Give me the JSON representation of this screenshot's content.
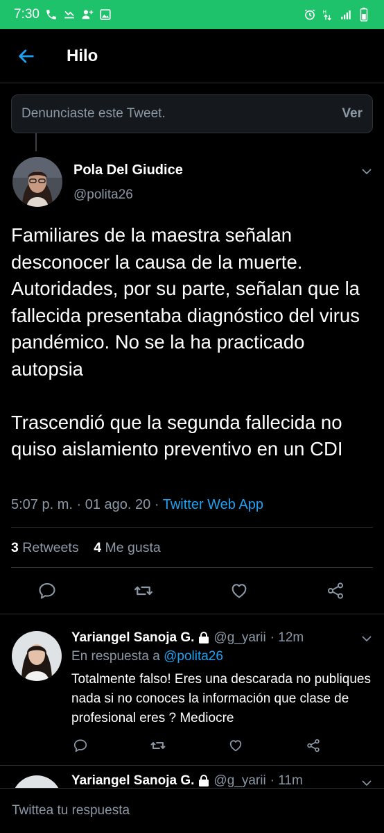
{
  "status_bar": {
    "time": "7:30",
    "left_icons": [
      "phone-call-icon",
      "missed-call-icon",
      "add-contact-icon",
      "gallery-icon"
    ],
    "right_icons": [
      "alarm-icon",
      "data-arrows-icon",
      "signal-icon",
      "battery-icon"
    ],
    "color": "#1dc26a"
  },
  "header": {
    "back_icon": "arrow-left-icon",
    "title": "Hilo"
  },
  "reported_notice": {
    "text": "Denunciaste este Tweet.",
    "action": "Ver"
  },
  "main_tweet": {
    "author_name": "Pola Del Giudice",
    "author_handle": "@polita26",
    "text": "Familiares de la maestra señalan desconocer la causa de la muerte. Autoridades, por su parte, señalan que la fallecida presentaba diagnóstico del virus pandémico. No se la ha practicado autopsia\n\nTrascendió que la segunda fallecida no quiso aislamiento preventivo en un CDI",
    "time": "5:07 p. m.",
    "separator": "·",
    "date": "01 ago. 20",
    "source": "Twitter Web App",
    "retweets_count": "3",
    "retweets_label": "Retweets",
    "likes_count": "4",
    "likes_label": "Me gusta",
    "actions": [
      "reply-icon",
      "retweet-icon",
      "like-icon",
      "share-icon"
    ]
  },
  "replies": [
    {
      "author_name": "Yariangel Sanoja G.",
      "author_handle": "@g_yarii",
      "time": "· 12m",
      "reply_to_label": "En respuesta a",
      "reply_to_handle": "@polita26",
      "text": "Totalmente falso! Eres una descarada no publiques nada si no conoces la información que clase de profesional eres ? Mediocre"
    },
    {
      "author_name": "Yariangel Sanoja G.",
      "author_handle": "@g_yarii",
      "time": "· 11m"
    }
  ],
  "compose": {
    "placeholder": "Twittea tu respuesta"
  },
  "colors": {
    "accent": "#1da1f2",
    "muted": "#8b98a5",
    "background": "#000000",
    "divider": "#2f3336"
  }
}
